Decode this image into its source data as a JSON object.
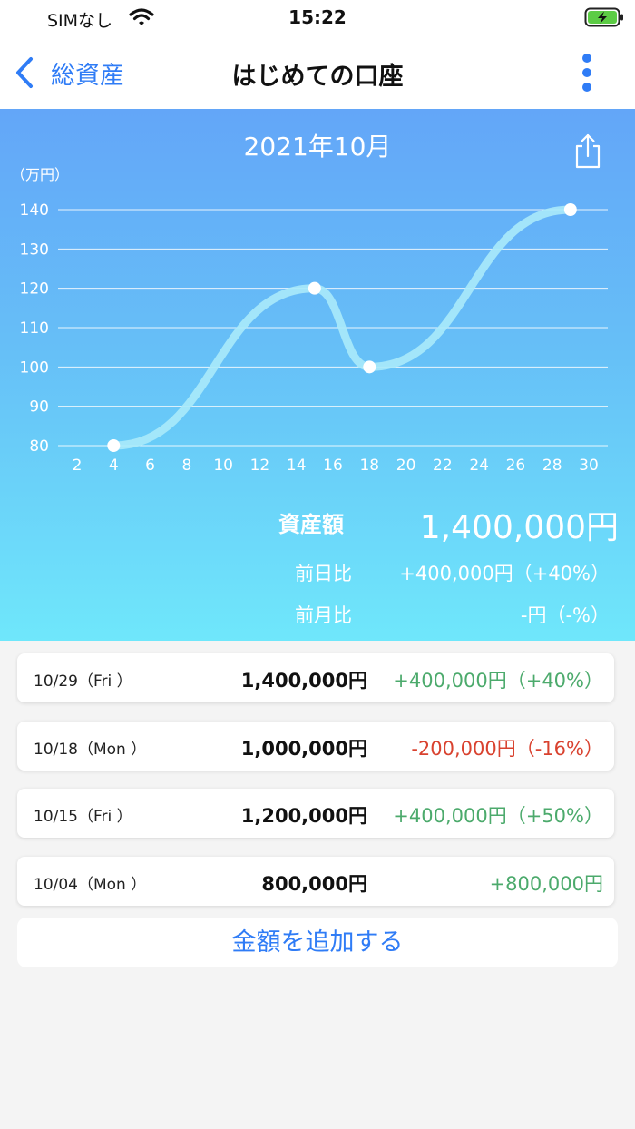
{
  "status_bar": {
    "carrier": "SIMなし",
    "time": "15:22"
  },
  "nav": {
    "back_label": "総資産",
    "title": "はじめての口座"
  },
  "chart": {
    "month_title": "2021年10月",
    "unit_label": "（万円）"
  },
  "chart_data": {
    "type": "line",
    "ylabel": "（万円）",
    "ylim": [
      80,
      140
    ],
    "y_ticks": [
      140,
      130,
      120,
      110,
      100,
      90,
      80
    ],
    "xlim": [
      2,
      30
    ],
    "x_ticks": [
      2,
      4,
      6,
      8,
      10,
      12,
      14,
      16,
      18,
      20,
      22,
      24,
      26,
      28,
      30
    ],
    "grid": true,
    "series": [
      {
        "x": [
          4,
          15,
          18,
          29
        ],
        "y": [
          80,
          120,
          100,
          140
        ]
      }
    ],
    "colors": {
      "line": "#aaeafa",
      "point": "#ffffff",
      "grid": "#ffffff"
    }
  },
  "summary": {
    "asset_label": "資産額",
    "asset_value": "1,400,000円",
    "day_label": "前日比",
    "day_value": "+400,000円（+40%）",
    "month_label": "前月比",
    "month_value": "-円（-%）"
  },
  "entries": [
    {
      "date": "10/29（Fri ）",
      "amount": "1,400,000円",
      "change": "+400,000円（+40%）",
      "change_color": "#4caa6c"
    },
    {
      "date": "10/18（Mon ）",
      "amount": "1,000,000円",
      "change": "-200,000円（-16%）",
      "change_color": "#d9422f"
    },
    {
      "date": "10/15（Fri ）",
      "amount": "1,200,000円",
      "change": "+400,000円（+50%）",
      "change_color": "#4caa6c"
    },
    {
      "date": "10/04（Mon ）",
      "amount": "800,000円",
      "change": "+800,000円",
      "change_color": "#4caa6c"
    }
  ],
  "add_button_label": "金額を追加する",
  "colors": {
    "accent": "#2f7cf6",
    "positive": "#4caa6c",
    "negative": "#d9422f"
  },
  "icons": [
    "wifi-icon",
    "battery-charging-icon",
    "chevron-left-icon",
    "more-vertical-icon",
    "share-icon"
  ]
}
